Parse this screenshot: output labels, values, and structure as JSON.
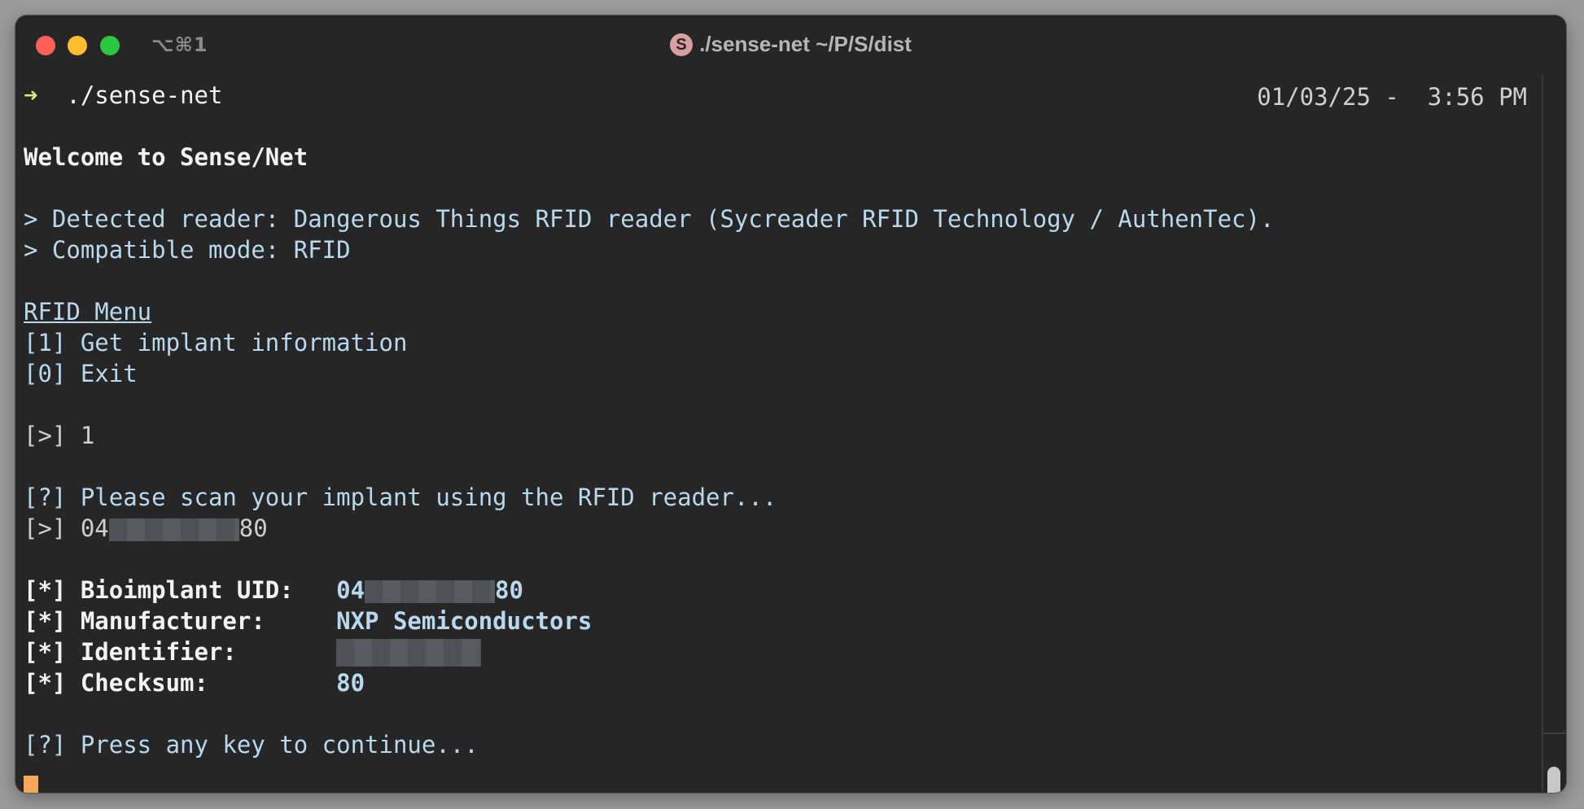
{
  "window": {
    "shortcut": "⌥⌘1",
    "title_icon_letter": "S",
    "title": "./sense-net ~/P/S/dist"
  },
  "prompt": {
    "arrow": "➜",
    "command": "./sense-net"
  },
  "right_info": "01/03/25 -  3:56 PM",
  "terminal": {
    "welcome": "Welcome to Sense/Net",
    "detected": "> Detected reader: Dangerous Things RFID reader (Sycreader RFID Technology / AuthenTec).",
    "compatible": "> Compatible mode: RFID",
    "menu_title": "RFID Menu",
    "menu_items": [
      "[1] Get implant information",
      "[0] Exit"
    ],
    "input_prompt": "[>] 1",
    "scan_msg": "[?] Please scan your implant using the RFID reader...",
    "scan_result_prefix": "[>] 04",
    "scan_result_suffix": "80",
    "fields": [
      {
        "label": "[*] Bioimplant UID:   ",
        "value_prefix": "04",
        "value_suffix": "80"
      },
      {
        "label": "[*] Manufacturer:     ",
        "value": "NXP Semiconductors"
      },
      {
        "label": "[*] Identifier:       "
      },
      {
        "label": "[*] Checksum:         ",
        "value": "80"
      }
    ],
    "continue_msg": "[?] Press any key to continue..."
  },
  "colors": {
    "background": "#262626",
    "text_blue": "#b8d8ee",
    "cursor": "#f7a65a",
    "prompt_arrow": "#c7f07a"
  }
}
